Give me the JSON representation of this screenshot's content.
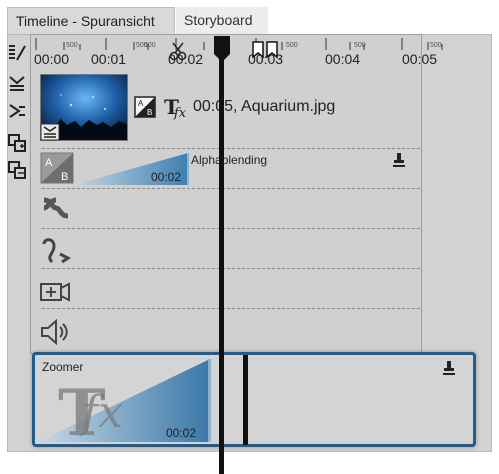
{
  "tabs": {
    "timeline": "Timeline - Spuransicht",
    "storyboard": "Storyboard"
  },
  "ruler": {
    "major": [
      "00:00",
      "00:01",
      "00:02",
      "00:03",
      "00:04",
      "00:05"
    ],
    "minor": [
      "500",
      "500",
      "500",
      "500",
      "500",
      "500"
    ]
  },
  "clip": {
    "info": "00:05, Aquarium.jpg",
    "transition_label": "Alphablending",
    "transition_time": "00:02"
  },
  "zoomer": {
    "label": "Zoomer",
    "time": "00:02"
  },
  "toolbar_icons": [
    "tracks-icon",
    "align-icon",
    "align-right-icon",
    "add-track-icon",
    "remove-track-icon"
  ],
  "colors": {
    "selection": "#1f5c8f",
    "ramp": "#4d8ab5"
  }
}
